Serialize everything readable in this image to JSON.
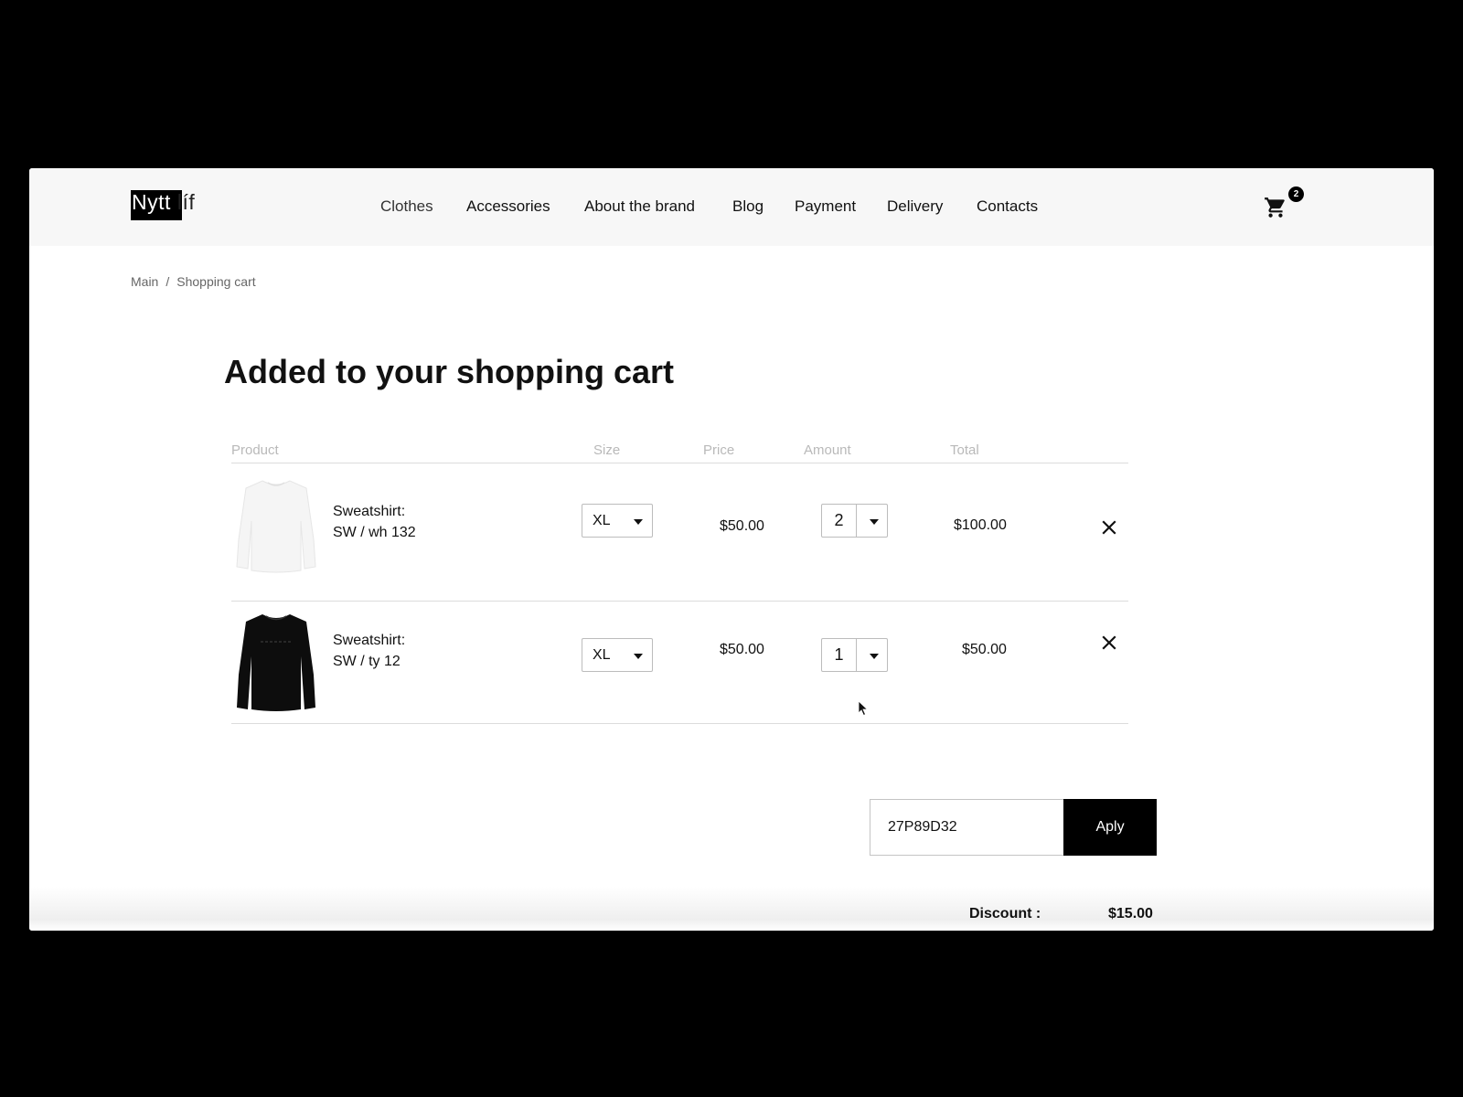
{
  "header": {
    "logo_main": "Nytt",
    "logo_suffix": "líf",
    "nav": [
      "Clothes",
      "Accessories",
      "About the brand",
      "Blog",
      "Payment",
      "Delivery",
      "Contacts"
    ],
    "cart_count": "2",
    "cart_icon": "cart-icon"
  },
  "breadcrumb": {
    "items": [
      "Main",
      "Shopping cart"
    ],
    "separator": "/"
  },
  "page_title": "Added to your shopping cart",
  "table": {
    "headers": [
      "Product",
      "Size",
      "Price",
      "Amount",
      "Total"
    ],
    "rows": [
      {
        "name_line1": "Sweatshirt:",
        "name_line2": "SW / wh 132",
        "size": "XL",
        "price": "$50.00",
        "amount": "2",
        "total": "$100.00",
        "image": "white-sweatshirt",
        "remove_icon": "close-icon"
      },
      {
        "name_line1": "Sweatshirt:",
        "name_line2": "SW / ty 12",
        "size": "XL",
        "price": "$50.00",
        "amount": "1",
        "total": "$50.00",
        "image": "black-sweatshirt",
        "remove_icon": "close-icon"
      }
    ]
  },
  "promo": {
    "code": "27P89D32",
    "button_label": "Aply"
  },
  "summary": {
    "discount_label": "Discount :",
    "discount_value": "$15.00"
  },
  "colors": {
    "page_bg": "#000000",
    "header_bg": "#f7f7f7",
    "accent": "#000000",
    "muted_text": "#b9b9b9"
  }
}
